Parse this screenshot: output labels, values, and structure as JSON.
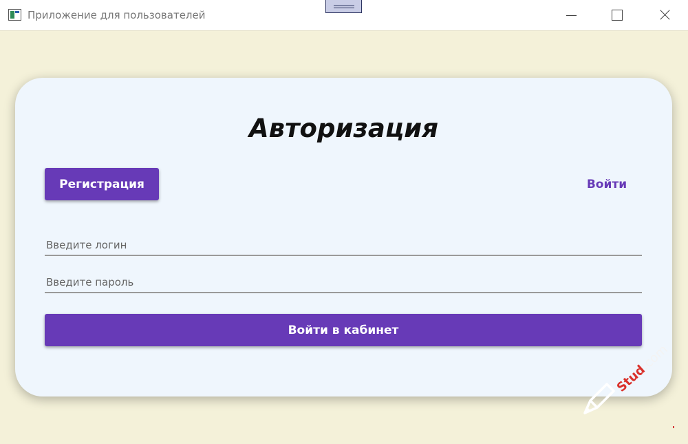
{
  "window": {
    "title": "Приложение для пользователей"
  },
  "auth": {
    "title": "Авторизация",
    "register_label": "Регистрация",
    "login_tab_label": "Войти",
    "login_placeholder": "Введите логин",
    "password_placeholder": "Введите пароль",
    "submit_label": "Войти в кабинет"
  },
  "watermark": {
    "text_main": "Stud",
    "text_faded": ".com"
  },
  "colors": {
    "accent": "#673ab7",
    "background": "#f4f1d9",
    "card": "#eff6fd"
  },
  "icons": [
    "app-icon",
    "minimize-icon",
    "maximize-icon",
    "close-icon",
    "pencil-icon"
  ]
}
